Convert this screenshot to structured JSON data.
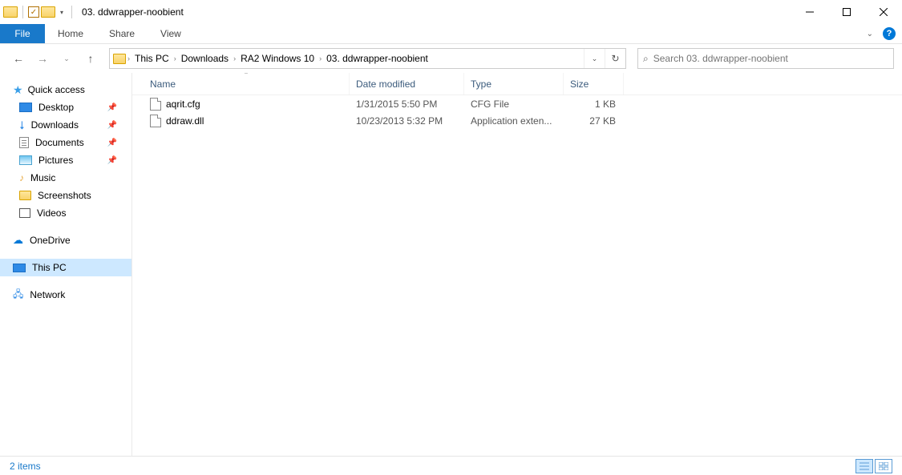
{
  "window": {
    "title": "03. ddwrapper-noobient"
  },
  "ribbon": {
    "file": "File",
    "tabs": [
      "Home",
      "Share",
      "View"
    ]
  },
  "breadcrumb": [
    "This PC",
    "Downloads",
    "RA2 Windows 10",
    "03. ddwrapper-noobient"
  ],
  "search": {
    "placeholder": "Search 03. ddwrapper-noobient"
  },
  "navpane": {
    "quick_access": "Quick access",
    "quick_items": [
      {
        "label": "Desktop",
        "pinned": true
      },
      {
        "label": "Downloads",
        "pinned": true
      },
      {
        "label": "Documents",
        "pinned": true
      },
      {
        "label": "Pictures",
        "pinned": true
      },
      {
        "label": "Music",
        "pinned": false
      },
      {
        "label": "Screenshots",
        "pinned": false
      },
      {
        "label": "Videos",
        "pinned": false
      }
    ],
    "onedrive": "OneDrive",
    "thispc": "This PC",
    "network": "Network"
  },
  "columns": {
    "name": "Name",
    "date": "Date modified",
    "type": "Type",
    "size": "Size"
  },
  "files": [
    {
      "name": "aqrit.cfg",
      "date": "1/31/2015 5:50 PM",
      "type": "CFG File",
      "size": "1 KB"
    },
    {
      "name": "ddraw.dll",
      "date": "10/23/2013 5:32 PM",
      "type": "Application exten...",
      "size": "27 KB"
    }
  ],
  "status": {
    "items": "2 items"
  }
}
